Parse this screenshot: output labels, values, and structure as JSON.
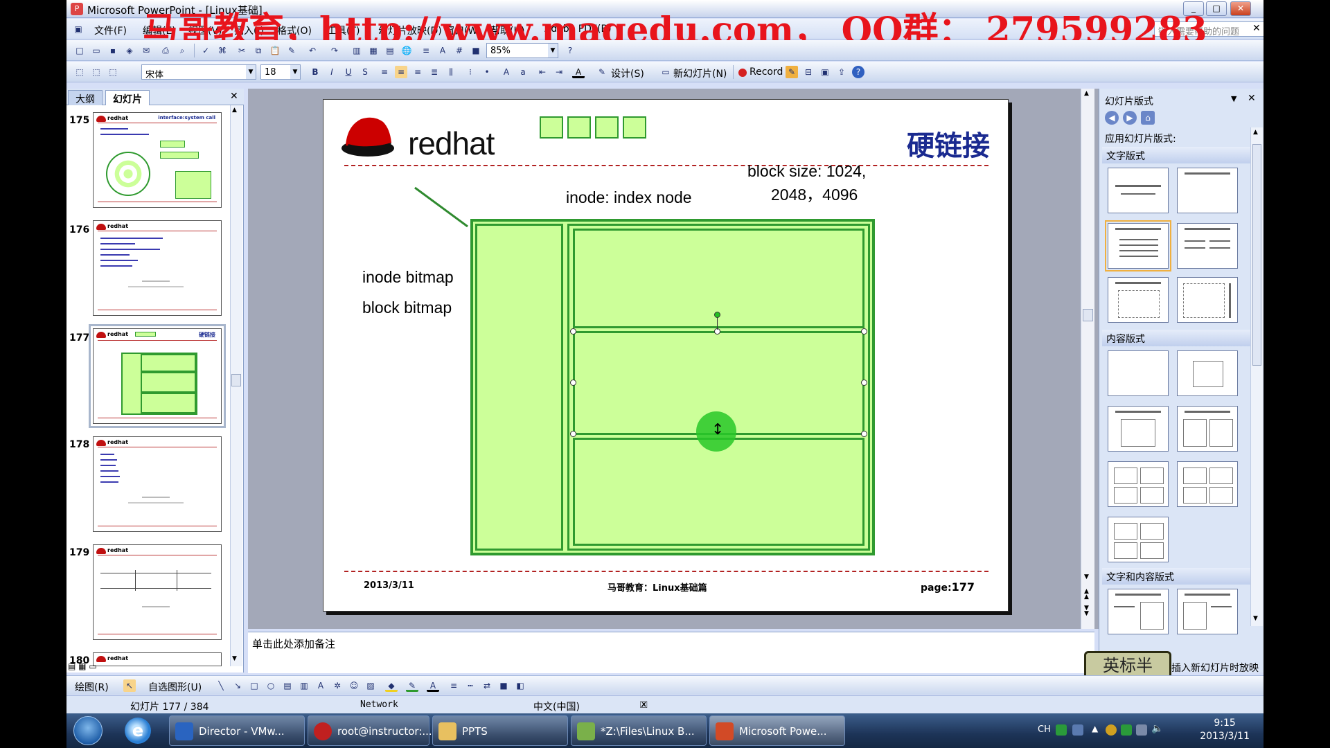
{
  "window": {
    "title": "Microsoft PowerPoint - [Linux基础]",
    "minimize": "_",
    "maximize": "□",
    "close": "✕"
  },
  "watermark": "马哥教育，http://www.magedu.com，  QQ群：  279599283",
  "menu": [
    "文件(F)",
    "编辑(E)",
    "视图(V)",
    "插入(I)",
    "格式(O)",
    "工具(T)",
    "幻灯片放映(D)",
    "窗口(W)",
    "帮助(H)",
    "Adobe PDF(B)"
  ],
  "help_box_placeholder": "键入需要帮助的问题",
  "toolbar1": {
    "zoom": "85%"
  },
  "toolbar2": {
    "font": "宋体",
    "size": "18",
    "design_label": "设计(S)",
    "new_slide_label": "新幻灯片(N)",
    "record_label": "Record"
  },
  "left_panel": {
    "tab_outline": "大纲",
    "tab_slides": "幻灯片",
    "thumbs": [
      {
        "num": "175",
        "title": "interface:system call"
      },
      {
        "num": "176",
        "title": ""
      },
      {
        "num": "177",
        "title": "硬链接"
      },
      {
        "num": "178",
        "title": ""
      },
      {
        "num": "179",
        "title": ""
      },
      {
        "num": "180",
        "title": ""
      }
    ]
  },
  "slide": {
    "logo_text": "redhat",
    "title": "硬链接",
    "block_size_line1": "block size: 1024,",
    "block_size_line2": "2048，4096",
    "inode_label": "inode: index node",
    "inode_bitmap": "inode bitmap",
    "block_bitmap": "block bitmap",
    "footer_date": "2013/3/11",
    "footer_center": "马哥教育：Linux基础篇",
    "footer_page_label": "page:",
    "footer_page_num": "177"
  },
  "notes_placeholder": "单击此处添加备注",
  "task_pane": {
    "title": "幻灯片版式",
    "apply_label": "应用幻灯片版式:",
    "section_text": "文字版式",
    "section_content": "内容版式",
    "section_text_content": "文字和内容版式",
    "show_when_inserting": "插入新幻灯片时放映",
    "stamp": "英标半"
  },
  "drawbar": {
    "draw_label": "绘图(R)",
    "autoshape_label": "自选图形(U)"
  },
  "status": {
    "slide_pos": "幻灯片 177 / 384",
    "design": "Network",
    "language": "中文(中国)"
  },
  "taskbar": {
    "buttons": [
      {
        "label": "Director - VMw..."
      },
      {
        "label": "root@instructor:..."
      },
      {
        "label": "PPTS"
      },
      {
        "label": "*Z:\\Files\\Linux B..."
      },
      {
        "label": "Microsoft Powe..."
      }
    ],
    "ime": "CH",
    "time": "9:15",
    "date": "2013/3/11"
  },
  "colors": {
    "slide_green_fill": "#ccff99",
    "slide_green_border": "#2f9a2f",
    "title_blue": "#1a2a90",
    "redhat_red": "#cc0000"
  }
}
